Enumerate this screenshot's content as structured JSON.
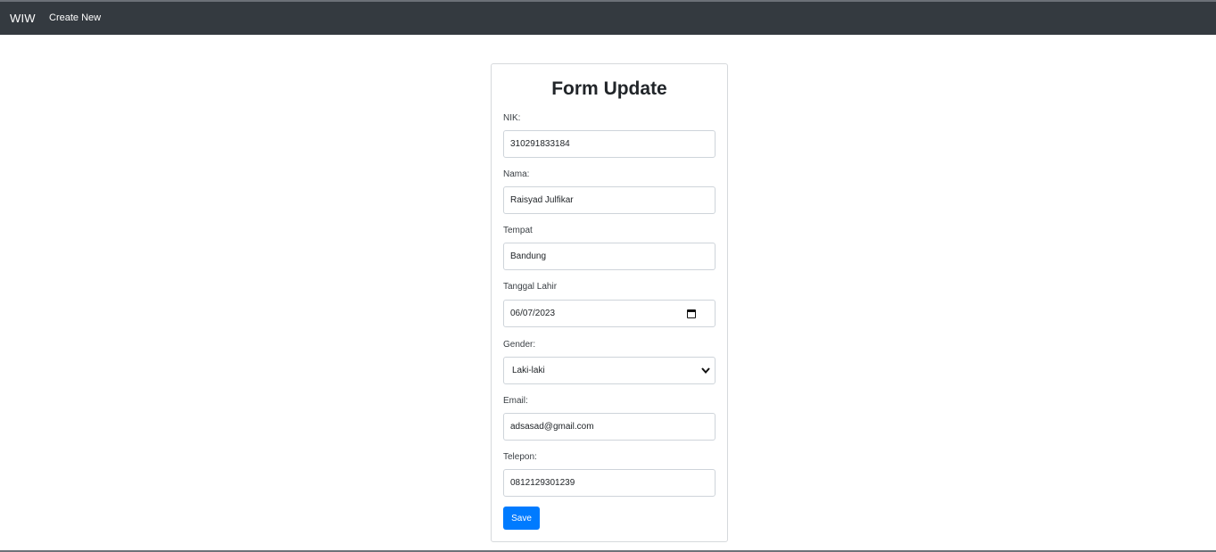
{
  "navbar": {
    "brand": "WIW",
    "links": [
      {
        "label": "Create New"
      }
    ]
  },
  "form": {
    "title": "Form Update",
    "fields": {
      "nik": {
        "label": "NIK:",
        "value": "310291833184"
      },
      "nama": {
        "label": "Nama:",
        "value": "Raisyad Julfikar"
      },
      "tempat": {
        "label": "Tempat",
        "value": "Bandung"
      },
      "tanggal_lahir": {
        "label": "Tanggal Lahir",
        "value": "06/07/2023",
        "icon": "calendar-icon"
      },
      "gender": {
        "label": "Gender:",
        "value": "Laki-laki",
        "icon": "chevron-down-icon"
      },
      "email": {
        "label": "Email:",
        "value": "adsasad@gmail.com"
      },
      "telepon": {
        "label": "Telepon:",
        "value": "0812129301239"
      }
    },
    "save_label": "Save"
  },
  "colors": {
    "navbar_bg": "#343a40",
    "primary": "#007bff",
    "border": "#ced4da"
  }
}
